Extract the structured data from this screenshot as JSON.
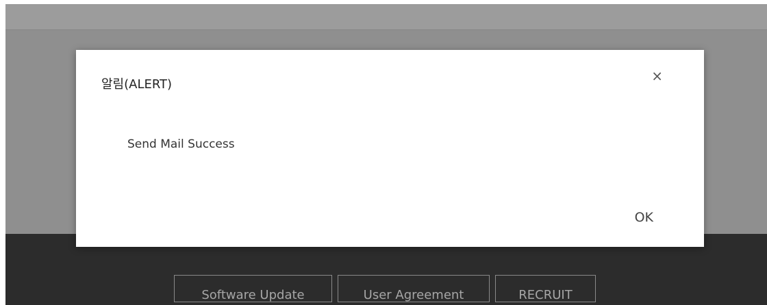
{
  "modal": {
    "title": "알림(ALERT)",
    "close_symbol": "×",
    "message": "Send Mail Success",
    "ok_label": "OK"
  },
  "footer": {
    "links": [
      "Software Update",
      "User Agreement",
      "RECRUIT"
    ]
  },
  "colors": {
    "overlay_gray": "#8f8f8f",
    "footer_dark": "#2c2c2c",
    "modal_bg": "#ffffff"
  }
}
